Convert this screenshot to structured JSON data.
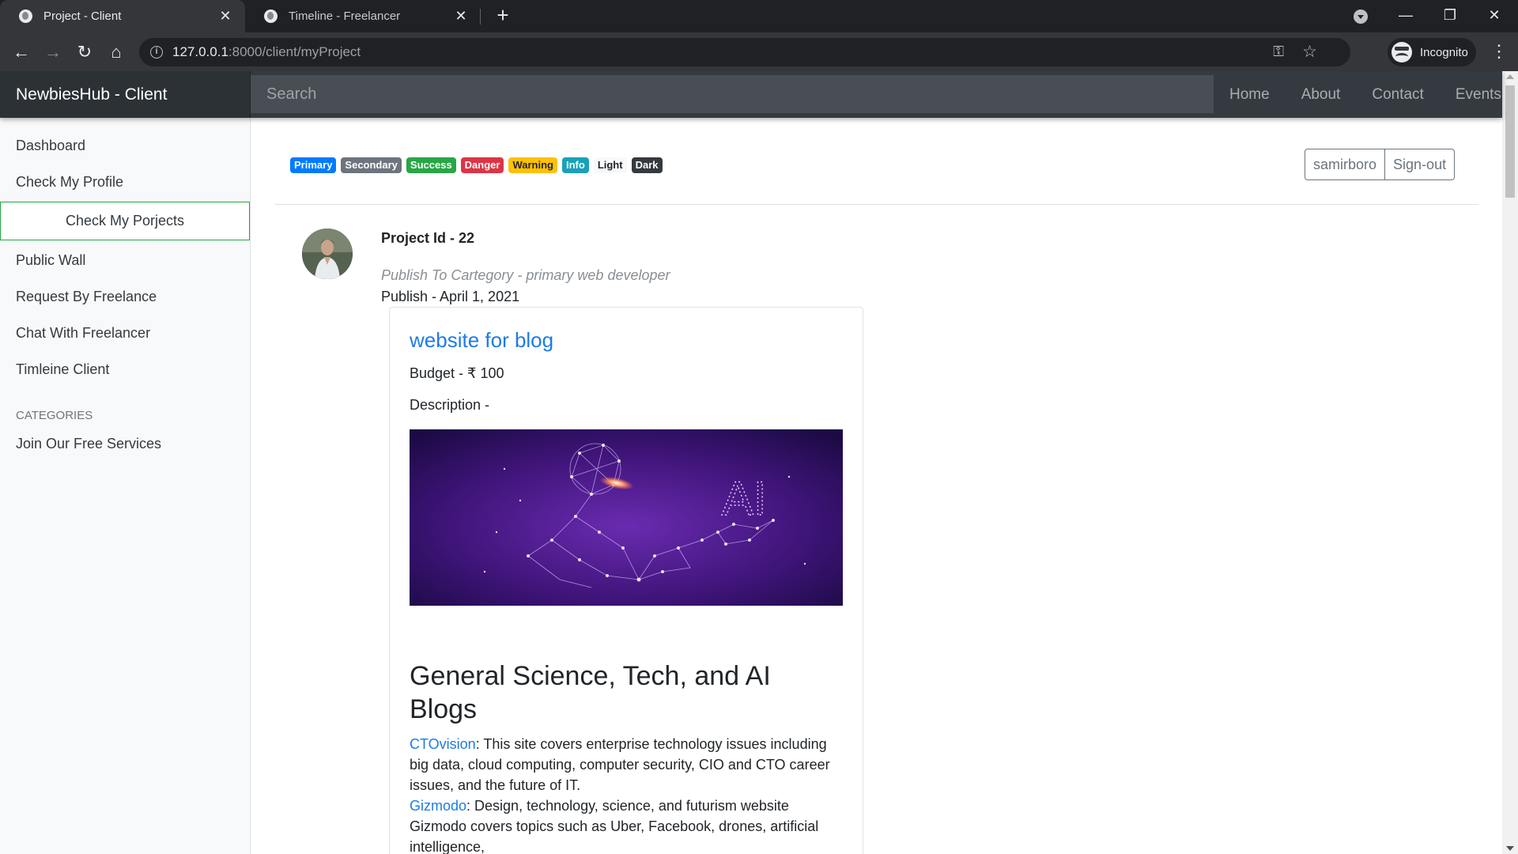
{
  "browser": {
    "tabs": [
      {
        "title": "Project - Client",
        "active": true
      },
      {
        "title": "Timeline - Freelancer",
        "active": false
      }
    ],
    "url_host": "127.0.0.1",
    "url_path": ":8000/client/myProject",
    "profile": "Incognito"
  },
  "navbar": {
    "brand": "NewbiesHub - Client",
    "search_placeholder": "Search",
    "links": [
      "Home",
      "About",
      "Contact",
      "Events"
    ]
  },
  "sidebar": {
    "items": [
      "Dashboard",
      "Check My Profile",
      "Check My Porjects",
      "Public Wall",
      "Request By Freelance",
      "Chat With Freelancer",
      "Timleine Client"
    ],
    "active_index": 2,
    "categories_heading": "CATEGORIES",
    "category_items": [
      "Join Our Free Services"
    ]
  },
  "badges": [
    {
      "label": "Primary",
      "color": "#007bff"
    },
    {
      "label": "Secondary",
      "color": "#6c757d"
    },
    {
      "label": "Success",
      "color": "#28a745"
    },
    {
      "label": "Danger",
      "color": "#dc3545"
    },
    {
      "label": "Warning",
      "color": "#ffc107"
    },
    {
      "label": "Info",
      "color": "#17a2b8"
    },
    {
      "label": "Light",
      "color": "#f8f9fa"
    },
    {
      "label": "Dark",
      "color": "#343a40"
    }
  ],
  "user": {
    "username": "samirboro",
    "signout_label": "Sign-out"
  },
  "project": {
    "id_label": "Project Id - 22",
    "category_label": "Publish To Cartegory - primary web developer",
    "publish_label": "Publish - April 1, 2021",
    "title": "website for blog",
    "budget_label": "Budget - ₹ 100",
    "description_label": "Description -",
    "blog_heading": "General Science, Tech, and AI Blogs",
    "blog_entries": [
      {
        "link": "CTOvision",
        "text": ": This site covers enterprise technology issues including big data, cloud computing, computer security, CIO and CTO career issues, and the future of IT."
      },
      {
        "link": "Gizmodo",
        "text": ": Design, technology, science, and futurism website Gizmodo covers topics such as Uber, Facebook, drones, artificial intelligence,"
      }
    ]
  },
  "image_overlay_text": "AI"
}
